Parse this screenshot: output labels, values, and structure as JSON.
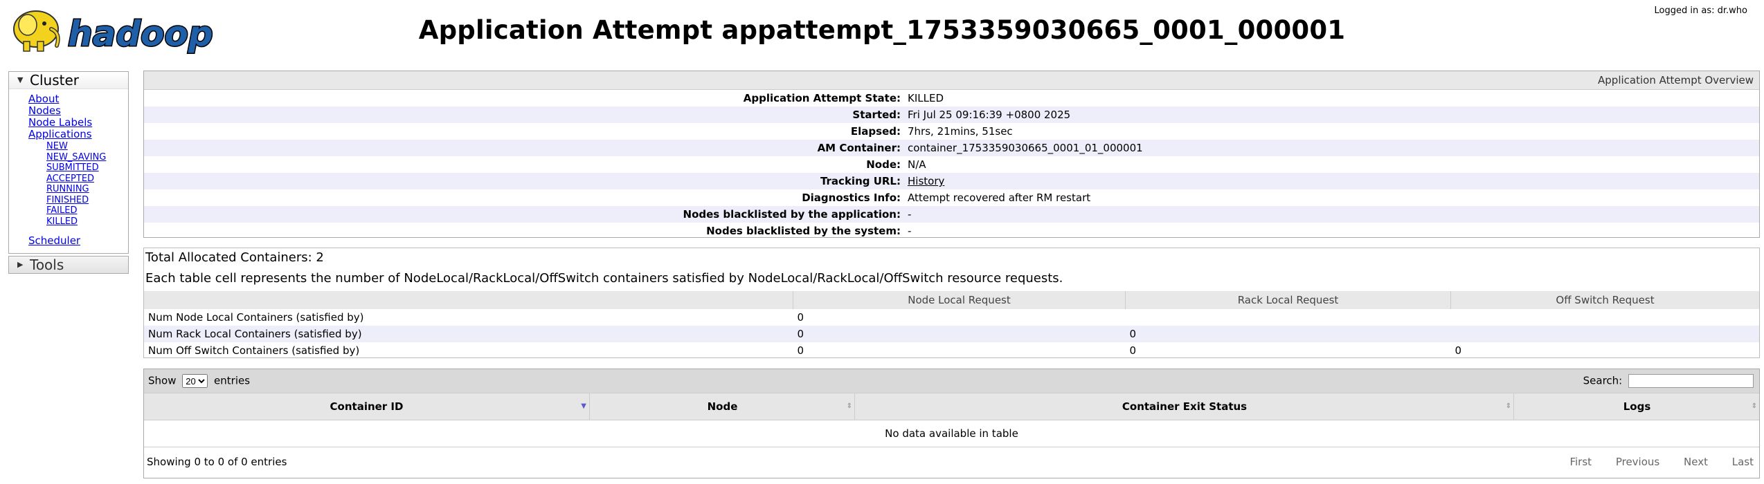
{
  "header": {
    "logo_text": "hadoop",
    "title": "Application Attempt appattempt_1753359030665_0001_000001",
    "logged_in": "Logged in as: dr.who"
  },
  "nav": {
    "cluster_label": "Cluster",
    "cluster_links": [
      "About",
      "Nodes",
      "Node Labels",
      "Applications"
    ],
    "app_states": [
      "NEW",
      "NEW_SAVING",
      "SUBMITTED",
      "ACCEPTED",
      "RUNNING",
      "FINISHED",
      "FAILED",
      "KILLED"
    ],
    "scheduler": "Scheduler",
    "tools_label": "Tools"
  },
  "overview": {
    "caption": "Application Attempt Overview",
    "rows": [
      {
        "label": "Application Attempt State:",
        "value": "KILLED"
      },
      {
        "label": "Started:",
        "value": "Fri Jul 25 09:16:39 +0800 2025"
      },
      {
        "label": "Elapsed:",
        "value": "7hrs, 21mins, 51sec"
      },
      {
        "label": "AM Container:",
        "value": "container_1753359030665_0001_01_000001"
      },
      {
        "label": "Node:",
        "value": "N/A"
      },
      {
        "label": "Tracking URL:",
        "value": "History"
      },
      {
        "label": "Diagnostics Info:",
        "value": "Attempt recovered after RM restart"
      },
      {
        "label": "Nodes blacklisted by the application:",
        "value": "-"
      },
      {
        "label": "Nodes blacklisted by the system:",
        "value": "-"
      }
    ]
  },
  "allocation": {
    "total": "Total Allocated Containers: 2",
    "description": "Each table cell represents the number of NodeLocal/RackLocal/OffSwitch containers satisfied by NodeLocal/RackLocal/OffSwitch resource requests.",
    "headers": [
      "",
      "Node Local Request",
      "Rack Local Request",
      "Off Switch Request"
    ],
    "rows": [
      {
        "label": "Num Node Local Containers (satisfied by)",
        "values": [
          "0",
          "",
          ""
        ]
      },
      {
        "label": "Num Rack Local Containers (satisfied by)",
        "values": [
          "0",
          "0",
          ""
        ]
      },
      {
        "label": "Num Off Switch Containers (satisfied by)",
        "values": [
          "0",
          "0",
          "0"
        ]
      }
    ]
  },
  "containers": {
    "show_label": "Show",
    "page_size": "20",
    "entries_label": "entries",
    "search_label": "Search:",
    "search_value": "",
    "columns": [
      "Container ID",
      "Node",
      "Container Exit Status",
      "Logs"
    ],
    "empty_message": "No data available in table",
    "info": "Showing 0 to 0 of 0 entries",
    "paging": [
      "First",
      "Previous",
      "Next",
      "Last"
    ]
  }
}
